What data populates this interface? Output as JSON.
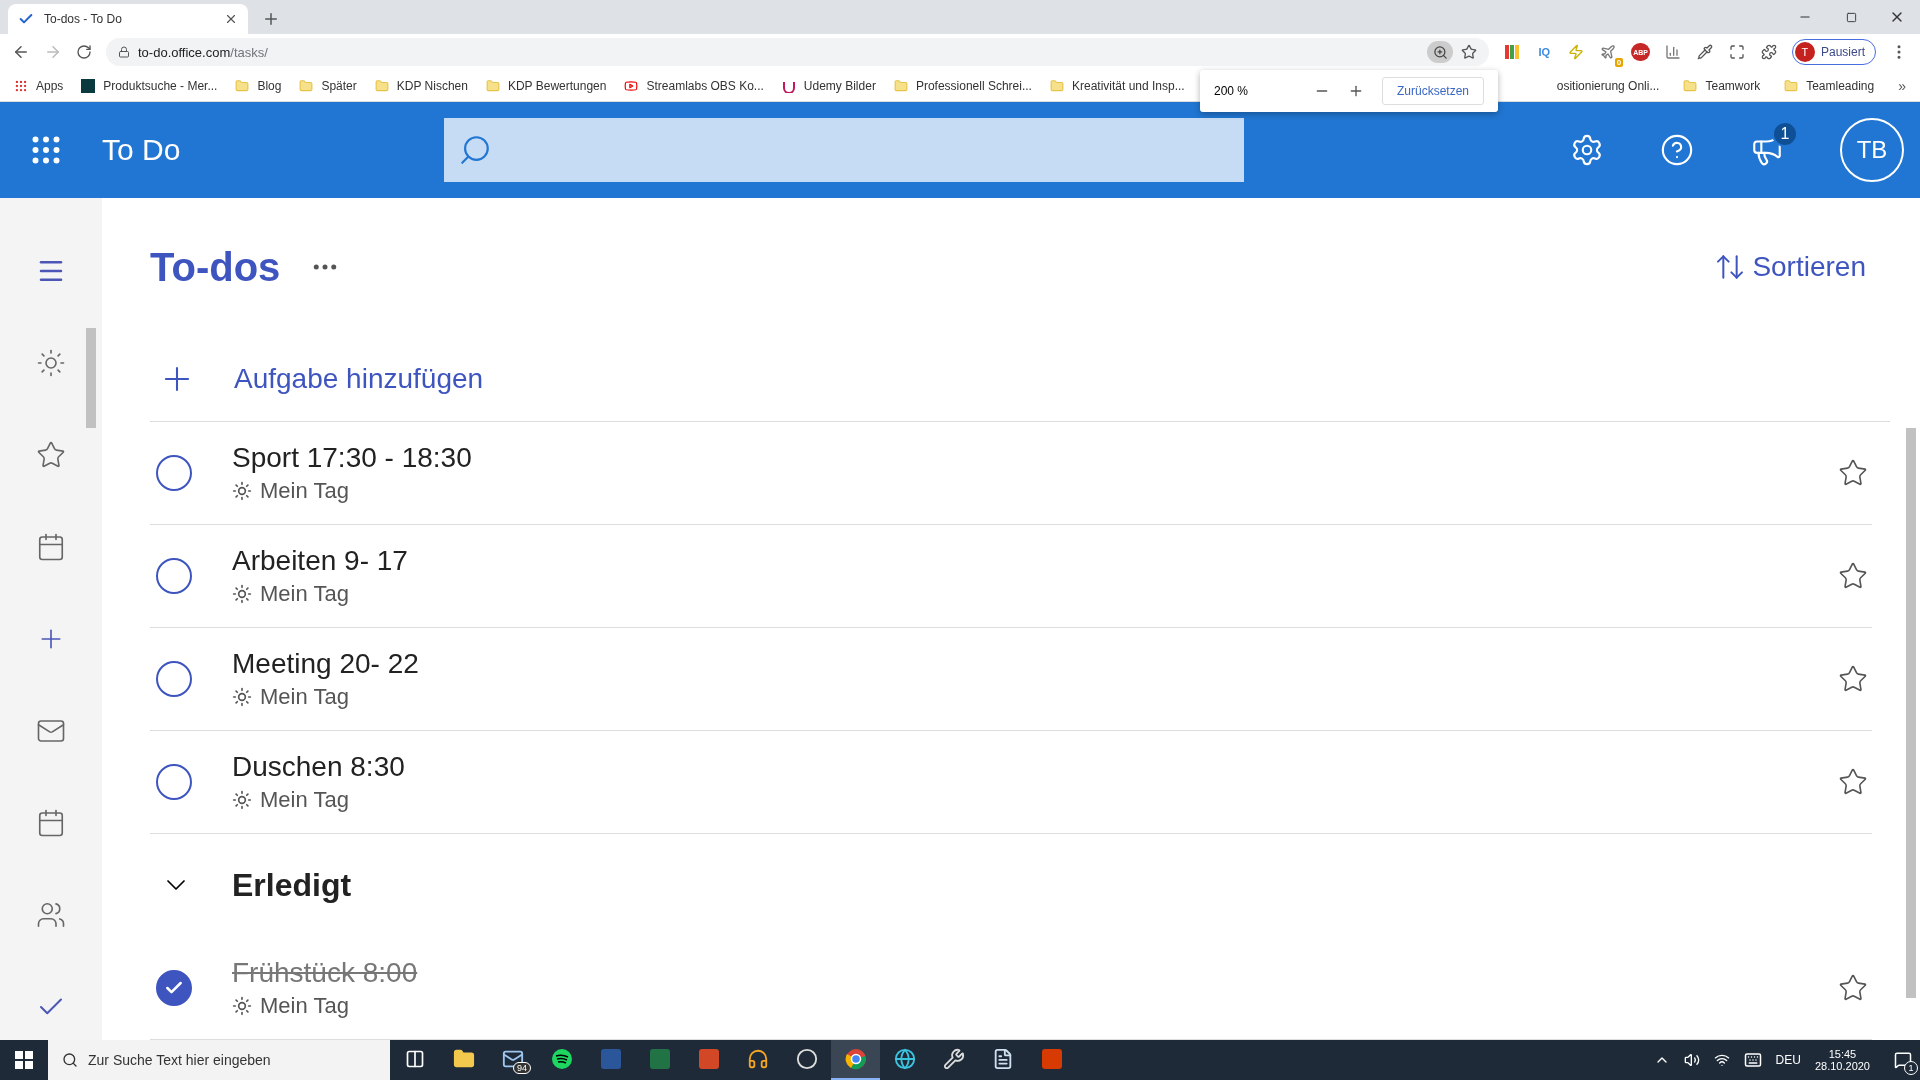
{
  "browser": {
    "tabs": [
      {
        "title": "To-dos - To Do",
        "selected": true
      }
    ],
    "url": {
      "host": "to-do.office.com",
      "path": "/tasks/"
    },
    "extensions": [
      {
        "kind": "colorful"
      },
      {
        "kind": "text",
        "label": "IQ"
      },
      {
        "kind": "bolt"
      },
      {
        "kind": "plane",
        "badge": "0"
      },
      {
        "kind": "stop",
        "label": "ABP"
      },
      {
        "kind": "bars"
      },
      {
        "kind": "dropper"
      },
      {
        "kind": "expand"
      },
      {
        "kind": "puzzle"
      }
    ],
    "profile": {
      "initial": "T",
      "label": "Pausiert"
    },
    "bookmarks": [
      {
        "kind": "apps",
        "label": "Apps"
      },
      {
        "kind": "site",
        "label": "Produktsuche - Mer..."
      },
      {
        "kind": "folder",
        "label": "Blog"
      },
      {
        "kind": "folder",
        "label": "Später"
      },
      {
        "kind": "folder",
        "label": "KDP Nischen"
      },
      {
        "kind": "folder",
        "label": "KDP Bewertungen"
      },
      {
        "kind": "video",
        "label": "Streamlabs OBS Ko..."
      },
      {
        "kind": "udemy",
        "label": "Udemy Bilder"
      },
      {
        "kind": "folder",
        "label": "Professionell Schrei..."
      },
      {
        "kind": "folder",
        "label": "Kreativität und Insp..."
      }
    ],
    "bookmarks_right": [
      {
        "kind": "plain",
        "label": "ositionierung Onli..."
      },
      {
        "kind": "folder",
        "label": "Teamwork"
      },
      {
        "kind": "folder",
        "label": "Teamleading"
      }
    ],
    "bookmarks_more": "»",
    "zoom_popup": {
      "value": "200 %",
      "reset": "Zurücksetzen"
    }
  },
  "app": {
    "name": "To Do",
    "notification_count": "1",
    "avatar": "TB"
  },
  "sidebar": {
    "items": [
      {
        "kind": "menu"
      },
      {
        "kind": "sun"
      },
      {
        "kind": "star"
      },
      {
        "kind": "calendar"
      },
      {
        "kind": "plus"
      },
      {
        "kind": "mail"
      },
      {
        "kind": "calendar"
      },
      {
        "kind": "people"
      },
      {
        "kind": "check"
      }
    ]
  },
  "list": {
    "title": "To-dos",
    "sort": "Sortieren",
    "add_task": "Aufgabe hinzufügen",
    "tasks": [
      {
        "title": "Sport 17:30 - 18:30",
        "list": "Mein Tag",
        "completed": false
      },
      {
        "title": "Arbeiten 9- 17",
        "list": "Mein Tag",
        "completed": false
      },
      {
        "title": "Meeting 20- 22",
        "list": "Mein Tag",
        "completed": false
      },
      {
        "title": "Duschen 8:30",
        "list": "Mein Tag",
        "completed": false
      }
    ],
    "completed_section": {
      "title": "Erledigt",
      "expanded": true,
      "tasks": [
        {
          "title": "Frühstück 8:00",
          "list": "Mein Tag",
          "completed": true
        }
      ]
    }
  },
  "taskbar": {
    "search_placeholder": "Zur Suche Text hier eingeben",
    "apps": [
      {
        "kind": "taskview",
        "selected": false
      },
      {
        "kind": "explorer",
        "selected": false
      },
      {
        "kind": "mail",
        "badge": "94",
        "selected": false
      },
      {
        "kind": "spotify",
        "selected": false
      },
      {
        "kind": "word",
        "selected": false
      },
      {
        "kind": "excel",
        "selected": false
      },
      {
        "kind": "powerpoint",
        "selected": false
      },
      {
        "kind": "headset",
        "selected": false
      },
      {
        "kind": "obs",
        "selected": false
      },
      {
        "kind": "chrome",
        "selected": true
      },
      {
        "kind": "edge",
        "selected": false
      },
      {
        "kind": "tool",
        "selected": false
      },
      {
        "kind": "doc",
        "selected": false
      },
      {
        "kind": "office",
        "selected": false
      }
    ],
    "language": "DEU",
    "time": "15:45",
    "date": "28.10.2020",
    "notifications": "1"
  }
}
